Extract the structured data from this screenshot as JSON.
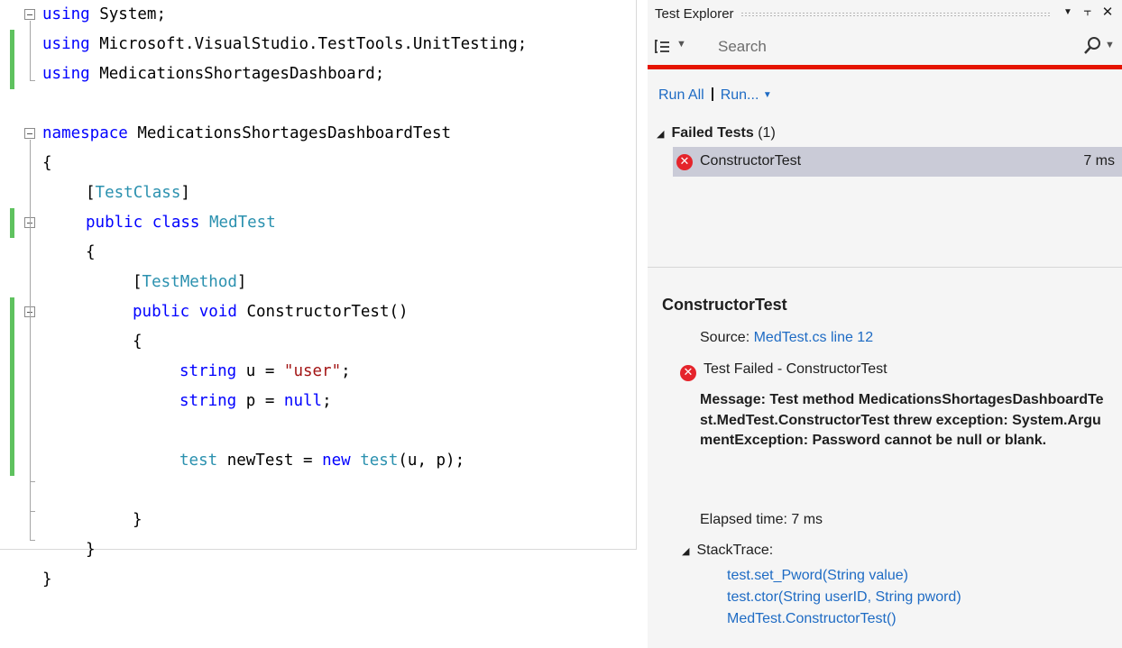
{
  "editor": {
    "lines": [
      [
        {
          "t": "using",
          "c": "kw"
        },
        {
          "t": " System;"
        }
      ],
      [
        {
          "t": "using",
          "c": "kw"
        },
        {
          "t": " Microsoft.VisualStudio.TestTools.UnitTesting;"
        }
      ],
      [
        {
          "t": "using",
          "c": "kw"
        },
        {
          "t": " MedicationsShortagesDashboard;"
        }
      ],
      [],
      [
        {
          "t": "namespace",
          "c": "kw"
        },
        {
          "t": " MedicationsShortagesDashboardTest"
        }
      ],
      [
        {
          "t": "{"
        }
      ],
      [
        {
          "t": "["
        },
        {
          "t": "TestClass",
          "c": "ty"
        },
        {
          "t": "]"
        }
      ],
      [
        {
          "t": "public",
          "c": "kw"
        },
        {
          "t": " "
        },
        {
          "t": "class",
          "c": "kw"
        },
        {
          "t": " "
        },
        {
          "t": "MedTest",
          "c": "ty"
        }
      ],
      [
        {
          "t": "{"
        }
      ],
      [
        {
          "t": "["
        },
        {
          "t": "TestMethod",
          "c": "ty"
        },
        {
          "t": "]"
        }
      ],
      [
        {
          "t": "public",
          "c": "kw"
        },
        {
          "t": " "
        },
        {
          "t": "void",
          "c": "kw"
        },
        {
          "t": " ConstructorTest()"
        }
      ],
      [
        {
          "t": "{"
        }
      ],
      [
        {
          "t": "string",
          "c": "kw"
        },
        {
          "t": " u = "
        },
        {
          "t": "\"user\"",
          "c": "str"
        },
        {
          "t": ";"
        }
      ],
      [
        {
          "t": "string",
          "c": "kw"
        },
        {
          "t": " p = "
        },
        {
          "t": "null",
          "c": "kw"
        },
        {
          "t": ";"
        }
      ],
      [],
      [
        {
          "t": "test",
          "c": "ty"
        },
        {
          "t": " newTest = "
        },
        {
          "t": "new",
          "c": "kw"
        },
        {
          "t": " "
        },
        {
          "t": "test",
          "c": "ty"
        },
        {
          "t": "(u, p);"
        }
      ],
      [],
      [
        {
          "t": "}"
        }
      ],
      [
        {
          "t": "}"
        }
      ],
      [
        {
          "t": "}"
        }
      ]
    ]
  },
  "test_explorer": {
    "title": "Test Explorer",
    "pin_glyph": "⫟",
    "close_glyph": "✕",
    "dropdown_glyph": "▼",
    "search_placeholder": "Search",
    "run_all_label": "Run All",
    "run_menu_label": "Run...",
    "group": {
      "name": "Failed Tests",
      "count": "(1)",
      "tests": [
        {
          "name": "ConstructorTest",
          "duration": "7 ms",
          "status": "failed"
        }
      ]
    },
    "detail": {
      "test_name": "ConstructorTest",
      "source_label": "Source:",
      "source_link": "MedTest.cs line 12",
      "status_text": "Test Failed - ConstructorTest",
      "message": "Message: Test method MedicationsShortagesDashboardTest.MedTest.ConstructorTest threw exception: System.ArgumentException: Password cannot be null or blank.",
      "elapsed": "Elapsed time: 7 ms",
      "stack_trace_label": "StackTrace:",
      "stack_trace": [
        "test.set_Pword(String value)",
        "test.ctor(String userID, String pword)",
        "MedTest.ConstructorTest()"
      ]
    },
    "colors": {
      "fail_red": "#e5242b",
      "status_bar": "#e51400",
      "link": "#1e6bc4",
      "selected_row": "#cacbd7",
      "change_bar": "#5fc25f",
      "keyword": "#0000ff",
      "type": "#2b91af",
      "string": "#a31515"
    }
  }
}
